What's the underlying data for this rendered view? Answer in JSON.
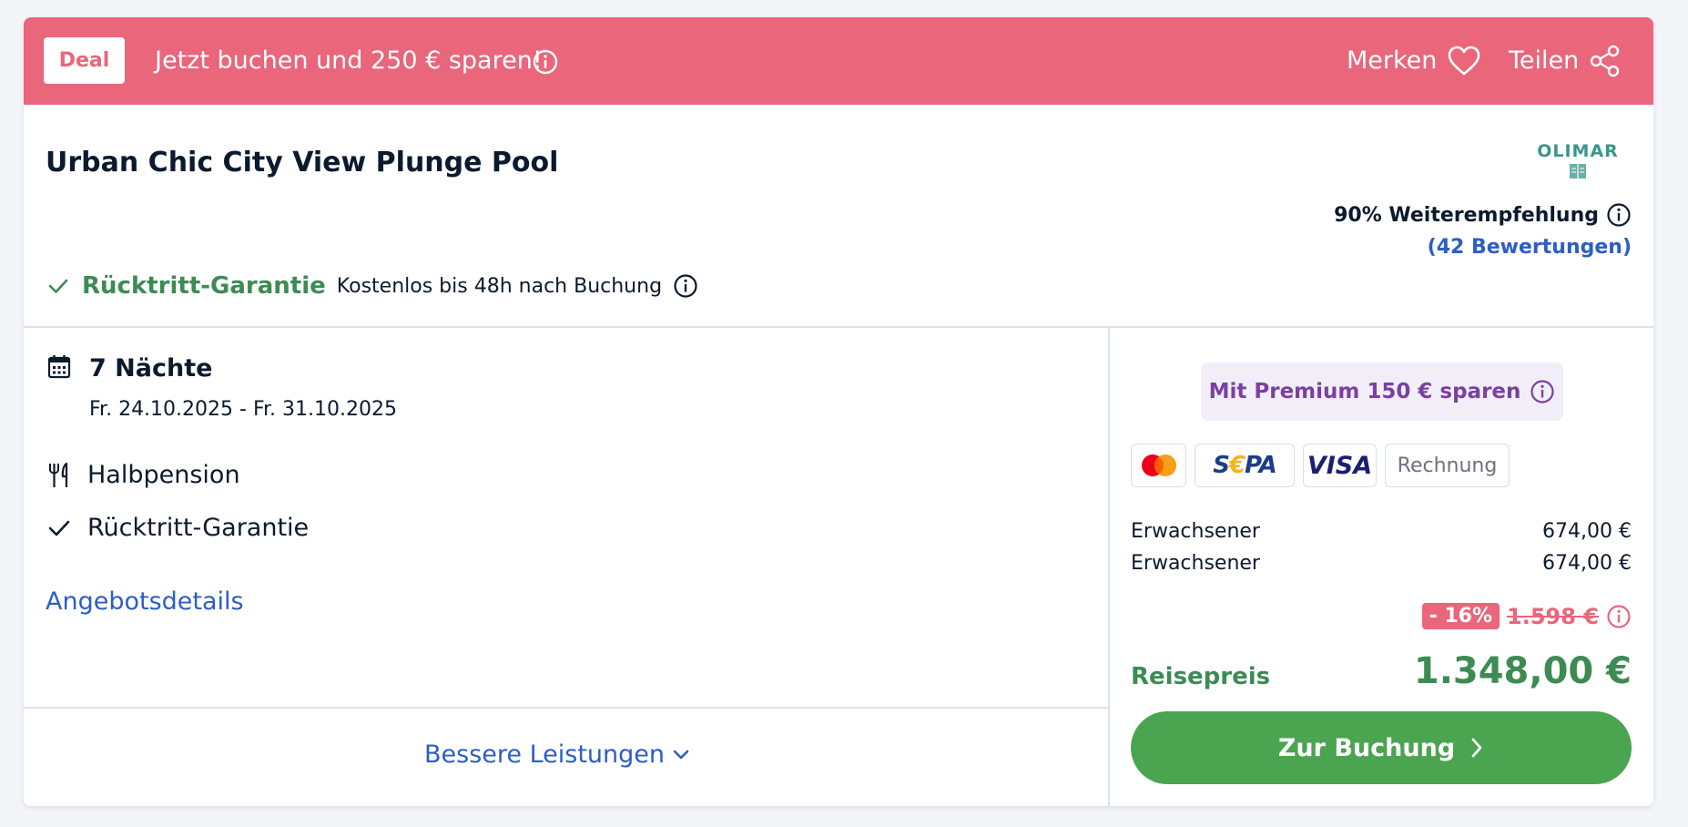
{
  "banner": {
    "deal_label": "Deal",
    "text": "Jetzt buchen und 250 € sparen!",
    "merken_label": "Merken",
    "teilen_label": "Teilen"
  },
  "offer": {
    "title": "Urban Chic City View Plunge Pool",
    "operator_logo_text": "OLIMAR",
    "recommendation": "90% Weiterempfehlung",
    "reviews": "(42 Bewertungen)",
    "guarantee_title": "Rücktritt-Garantie",
    "guarantee_text": "Kostenlos bis 48h nach Buchung"
  },
  "details": {
    "nights": "7 Nächte",
    "dates": "Fr. 24.10.2025 - Fr. 31.10.2025",
    "features": [
      {
        "icon": "cutlery-icon",
        "label": "Halbpension"
      },
      {
        "icon": "check-icon",
        "label": "Rücktritt-Garantie"
      }
    ],
    "offer_details_link": "Angebotsdetails",
    "better_services_link": "Bessere Leistungen"
  },
  "pricing": {
    "premium": "Mit Premium 150 € sparen",
    "payment_methods": [
      "Mastercard",
      "SEPA",
      "VISA",
      "Rechnung"
    ],
    "sepa_parts": [
      "S",
      "€",
      "PA"
    ],
    "visa_text": "VISA",
    "rechnung_text": "Rechnung",
    "travelers": [
      {
        "label": "Erwachsener",
        "price": "674,00 €"
      },
      {
        "label": "Erwachsener",
        "price": "674,00 €"
      }
    ],
    "discount": "- 16%",
    "old_price": "1.598 €",
    "total_label": "Reisepreis",
    "total": "1.348,00 €",
    "book_button": "Zur Buchung"
  },
  "colors": {
    "banner": "#e9667b",
    "green": "#3d8b53",
    "button_green": "#4aa450",
    "link_blue": "#2c5ec4",
    "premium_purple": "#7b3fa3"
  }
}
